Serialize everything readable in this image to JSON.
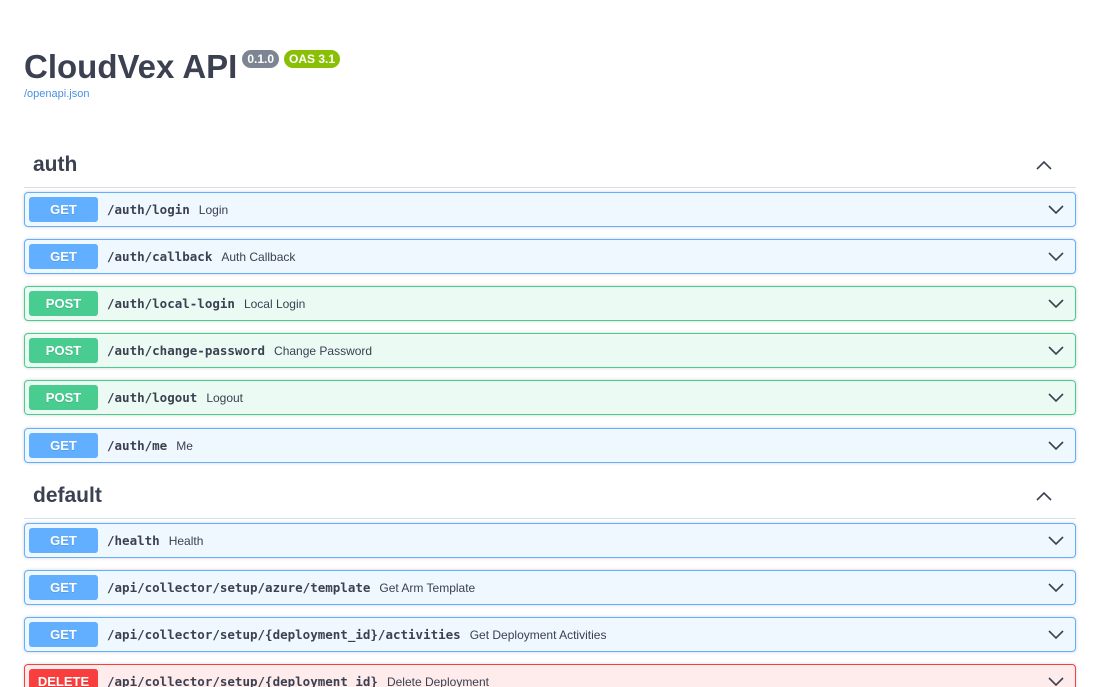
{
  "info": {
    "title": "CloudVex API",
    "version": "0.1.0",
    "oas": "OAS 3.1",
    "spec_link": "/openapi.json"
  },
  "colors": {
    "get": "#61affe",
    "post": "#49cc90",
    "delete": "#f93e3e",
    "text": "#3b4151",
    "link": "#4990e2"
  },
  "sections": [
    {
      "name": "auth",
      "toggle_icon": "chevron-up-icon",
      "operations": [
        {
          "method": "GET",
          "path": "/auth/login",
          "summary": "Login"
        },
        {
          "method": "GET",
          "path": "/auth/callback",
          "summary": "Auth Callback"
        },
        {
          "method": "POST",
          "path": "/auth/local-login",
          "summary": "Local Login"
        },
        {
          "method": "POST",
          "path": "/auth/change-password",
          "summary": "Change Password"
        },
        {
          "method": "POST",
          "path": "/auth/logout",
          "summary": "Logout"
        },
        {
          "method": "GET",
          "path": "/auth/me",
          "summary": "Me"
        }
      ]
    },
    {
      "name": "default",
      "toggle_icon": "chevron-up-icon",
      "operations": [
        {
          "method": "GET",
          "path": "/health",
          "summary": "Health"
        },
        {
          "method": "GET",
          "path": "/api/collector/setup/azure/template",
          "summary": "Get Arm Template"
        },
        {
          "method": "GET",
          "path": "/api/collector/setup/{deployment_id}/activities",
          "summary": "Get Deployment Activities"
        },
        {
          "method": "DELETE",
          "path": "/api/collector/setup/{deployment_id}",
          "summary": "Delete Deployment"
        }
      ]
    }
  ]
}
